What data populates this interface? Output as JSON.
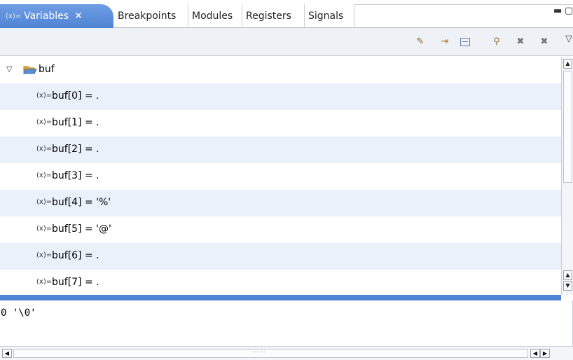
{
  "tabs": {
    "active": {
      "label": "Variables",
      "icon": "variables-icon",
      "close_glyph": "✕",
      "icon_glyph": "(x)="
    },
    "others": [
      "Breakpoints",
      "Modules",
      "Registers",
      "Signals"
    ]
  },
  "window": {
    "minimize": "▬",
    "maximize": "▢"
  },
  "toolbar": {
    "icons": [
      "show-type-names-icon",
      "show-logical-structure-icon",
      "collapse-all-icon",
      "connect-icon",
      "remove-icon",
      "remove-all-icon",
      "view-menu-icon"
    ]
  },
  "tree": {
    "root": {
      "label": "buf",
      "icon": "folder-open-icon",
      "expanded": true
    },
    "rows": [
      {
        "text": "buf[0] = ."
      },
      {
        "text": "buf[1] = ."
      },
      {
        "text": "buf[2] = ."
      },
      {
        "text": "buf[3] = ."
      },
      {
        "text": "buf[4] = '%'"
      },
      {
        "text": "buf[5] = '@'"
      },
      {
        "text": "buf[6] = ."
      },
      {
        "text": "buf[7] = ."
      }
    ],
    "var_icon_glyph": "(x)="
  },
  "detail": {
    "text": "0 '\\0'"
  },
  "colors": {
    "accent": "#4f83d4",
    "row_alt": "#eaf1fa"
  }
}
